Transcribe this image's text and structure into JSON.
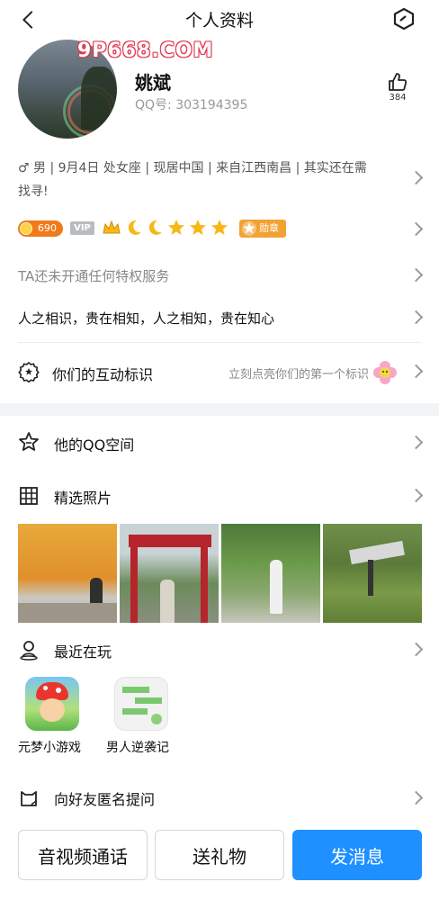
{
  "header": {
    "title": "个人资料"
  },
  "watermark": "9P668.COM",
  "profile": {
    "name": "姚斌",
    "qq_label": "QQ号: 303194395",
    "like_count": "384",
    "details": "♂ 男 | 9月4日 处女座 | 现居中国 | 来自江西南昌 | 其实还在需找寻!",
    "coin": "690",
    "vip_badge": "VIP",
    "medal_label": "勋章",
    "privilege_text": "TA还未开通任何特权服务",
    "signature": "人之相识，贵在相知，人之相知，贵在知心"
  },
  "interaction": {
    "label": "你们的互动标识",
    "hint": "立刻点亮你们的第一个标识"
  },
  "sections": {
    "qzone": "他的QQ空间",
    "photos": "精选照片",
    "recent": "最近在玩",
    "ask": "向好友匿名提问"
  },
  "games": [
    {
      "name": "元梦小游戏"
    },
    {
      "name": "男人逆袭记"
    }
  ],
  "bottom": {
    "call": "音视频通话",
    "gift": "送礼物",
    "message": "发消息"
  },
  "colors": {
    "accent": "#1e90ff",
    "gold": "#f5a623"
  }
}
